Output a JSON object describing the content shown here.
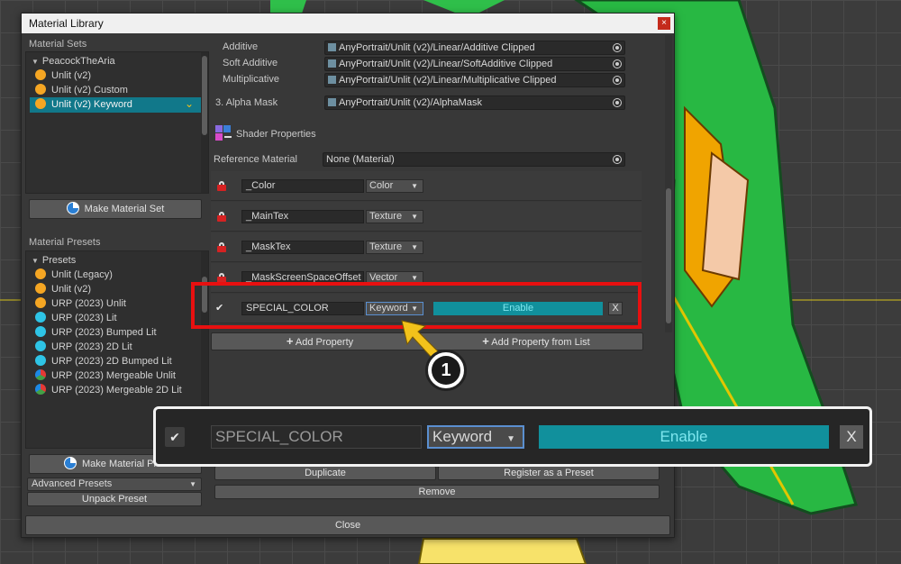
{
  "window": {
    "title": "Material Library"
  },
  "left": {
    "sets_label": "Material Sets",
    "sets_root": "PeacockTheAria",
    "sets": [
      {
        "label": "Unlit (v2)",
        "color": "#f5a623"
      },
      {
        "label": "Unlit (v2) Custom",
        "color": "#f5a623"
      },
      {
        "label": "Unlit (v2) Keyword",
        "color": "#f5a623"
      }
    ],
    "make_set_button": "Make Material Set",
    "presets_label": "Material Presets",
    "presets_root": "Presets",
    "presets": [
      {
        "label": "Unlit (Legacy)",
        "color": "#f5a623"
      },
      {
        "label": "Unlit (v2)",
        "color": "#f5a623"
      },
      {
        "label": "URP (2023) Unlit",
        "color": "#f5a623"
      },
      {
        "label": "URP (2023) Lit",
        "color": "#2ec4e6"
      },
      {
        "label": "URP (2023) Bumped Lit",
        "color": "#2ec4e6"
      },
      {
        "label": "URP (2023) 2D Lit",
        "color": "#2ec4e6"
      },
      {
        "label": "URP (2023) 2D Bumped Lit",
        "color": "#2ec4e6"
      },
      {
        "label": "URP (2023) Mergeable Unlit",
        "color": "multi"
      },
      {
        "label": "URP (2023) Mergeable 2D Lit",
        "color": "multi"
      }
    ],
    "make_preset_button": "Make Material Pr",
    "advanced_presets": "Advanced Presets",
    "unpack_preset": "Unpack Preset"
  },
  "right": {
    "blend_rows": [
      {
        "label": "Additive",
        "value": "AnyPortrait/Unlit (v2)/Linear/Additive Clipped"
      },
      {
        "label": "Soft Additive",
        "value": "AnyPortrait/Unlit (v2)/Linear/SoftAdditive Clipped"
      },
      {
        "label": "Multiplicative",
        "value": "AnyPortrait/Unlit (v2)/Linear/Multiplicative Clipped"
      }
    ],
    "alpha_mask_label": "3. Alpha Mask",
    "alpha_mask_value": "AnyPortrait/Unlit (v2)/AlphaMask",
    "shader_properties_title": "Shader Properties",
    "reference_material_label": "Reference Material",
    "reference_material_value": "None (Material)",
    "properties": [
      {
        "name": "_Color",
        "type": "Color"
      },
      {
        "name": "_MainTex",
        "type": "Texture"
      },
      {
        "name": "_MaskTex",
        "type": "Texture"
      },
      {
        "name": "_MaskScreenSpaceOffset",
        "type": "Vector"
      }
    ],
    "keyword_row": {
      "name": "SPECIAL_COLOR",
      "type": "Keyword",
      "state": "Enable",
      "remove": "X"
    },
    "add_property": "Add Property",
    "add_property_from_list": "Add Property from List",
    "duplicate": "Duplicate",
    "register_preset": "Register as a Preset",
    "remove": "Remove"
  },
  "close_button": "Close",
  "callout_number": "1",
  "zoom": {
    "name": "SPECIAL_COLOR",
    "type": "Keyword",
    "state": "Enable",
    "remove": "X"
  },
  "colors": {
    "accent": "#11909c",
    "selection": "#11788a",
    "callout": "#e81010",
    "arrow": "#f2c21b"
  }
}
